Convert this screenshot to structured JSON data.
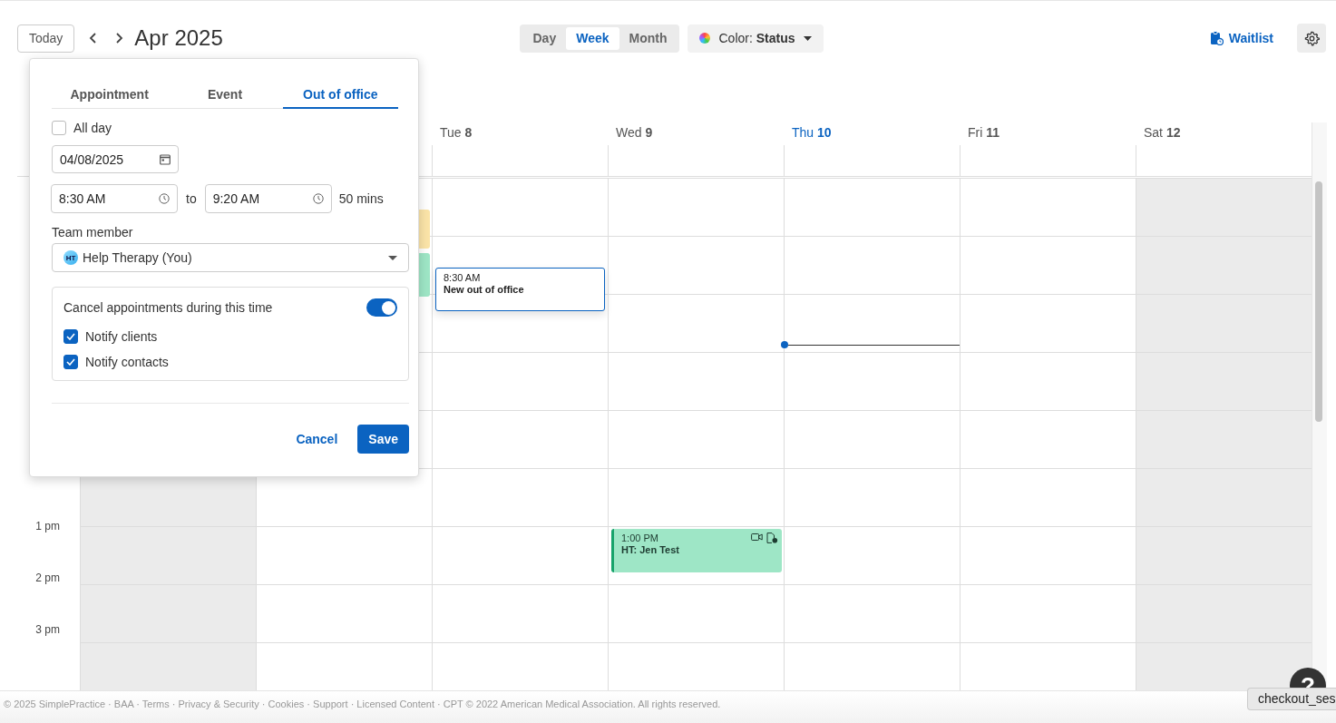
{
  "toolbar": {
    "today": "Today",
    "title": "Apr 2025",
    "views": [
      {
        "label": "Day",
        "selected": false
      },
      {
        "label": "Week",
        "selected": true
      },
      {
        "label": "Month",
        "selected": false
      }
    ],
    "color_filter": "Color: **Status**",
    "waitlist": "Waitlist"
  },
  "calendar": {
    "days": [
      {
        "weekend": true,
        "today": false
      },
      {
        "weekend": false,
        "today": false,
        "events": [
          {
            "kind": "appointment",
            "color": "#fbe4a8"
          },
          {
            "kind": "appointment",
            "color": "#9ee6c6"
          }
        ]
      },
      {
        "weekday": "Tue",
        "date": "8",
        "weekend": false,
        "today": false,
        "events": [
          {
            "kind": "draft",
            "time": "8:30 AM",
            "title": "New out of office"
          }
        ]
      },
      {
        "weekday": "Wed",
        "date": "9",
        "weekend": false,
        "today": false,
        "events": [
          {
            "kind": "appointment",
            "time": "1:00 PM",
            "title": "HT: Jen Test",
            "color": "#9ee6c6",
            "video": true
          }
        ]
      },
      {
        "weekday": "Thu",
        "date": "10",
        "weekend": false,
        "today": true
      },
      {
        "weekday": "Fri",
        "date": "11",
        "weekend": false,
        "today": false
      },
      {
        "weekday": "Sat",
        "date": "12",
        "weekend": true,
        "today": false
      }
    ],
    "hour_labels": [
      "1 pm",
      "2 pm",
      "3 pm"
    ]
  },
  "popover": {
    "tabs": [
      {
        "label": "Appointment",
        "selected": false
      },
      {
        "label": "Event",
        "selected": false
      },
      {
        "label": "Out of office",
        "selected": true
      }
    ],
    "all_day": {
      "label": "All day",
      "checked": false
    },
    "date": "04/08/2025",
    "start_time": "8:30 AM",
    "to": "to",
    "end_time": "9:20 AM",
    "duration": "50 mins",
    "team_member": {
      "label": "Team member",
      "initials": "HT",
      "value": "Help Therapy (You)"
    },
    "cancel_appointments": {
      "label": "Cancel appointments during this time",
      "on": true,
      "options": [
        {
          "label": "Notify clients",
          "checked": true
        },
        {
          "label": "Notify contacts",
          "checked": true
        }
      ]
    },
    "cancel": "Cancel",
    "save": "Save"
  },
  "footer": "© 2025 SimplePractice · BAA · Terms · Privacy & Security · Cookies · Support · Licensed Content · CPT © 2022 American Medical Association. All rights reserved.",
  "help": {
    "label": "?",
    "tooltip": "checkout_ses"
  }
}
